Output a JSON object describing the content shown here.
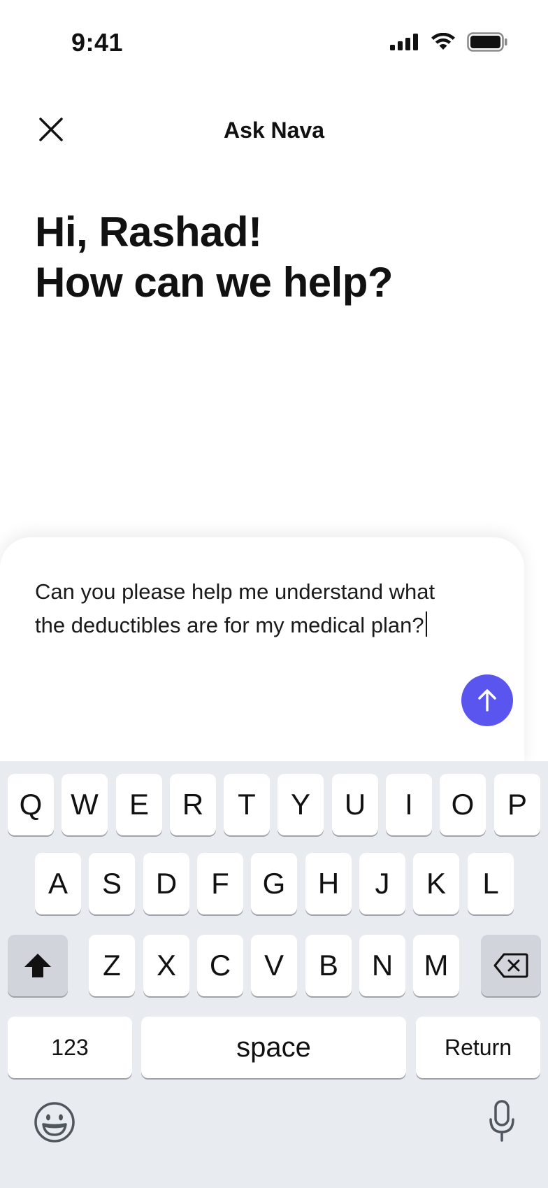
{
  "status_bar": {
    "time": "9:41"
  },
  "header": {
    "title": "Ask Nava"
  },
  "greeting": {
    "line1": "Hi, Rashad!",
    "line2": "How can we help?"
  },
  "composer": {
    "text_line1": "Can you please help me understand what",
    "text_line2": "the deductibles are for my medical plan?"
  },
  "keyboard": {
    "row1": [
      "Q",
      "W",
      "E",
      "R",
      "T",
      "Y",
      "U",
      "I",
      "O",
      "P"
    ],
    "row2": [
      "A",
      "S",
      "D",
      "F",
      "G",
      "H",
      "J",
      "K",
      "L"
    ],
    "row3": [
      "Z",
      "X",
      "C",
      "V",
      "B",
      "N",
      "M"
    ],
    "numbers_label": "123",
    "space_label": "space",
    "return_label": "Return"
  },
  "colors": {
    "accent": "#5b55f0",
    "keyboard_bg": "#e8ebf0"
  }
}
